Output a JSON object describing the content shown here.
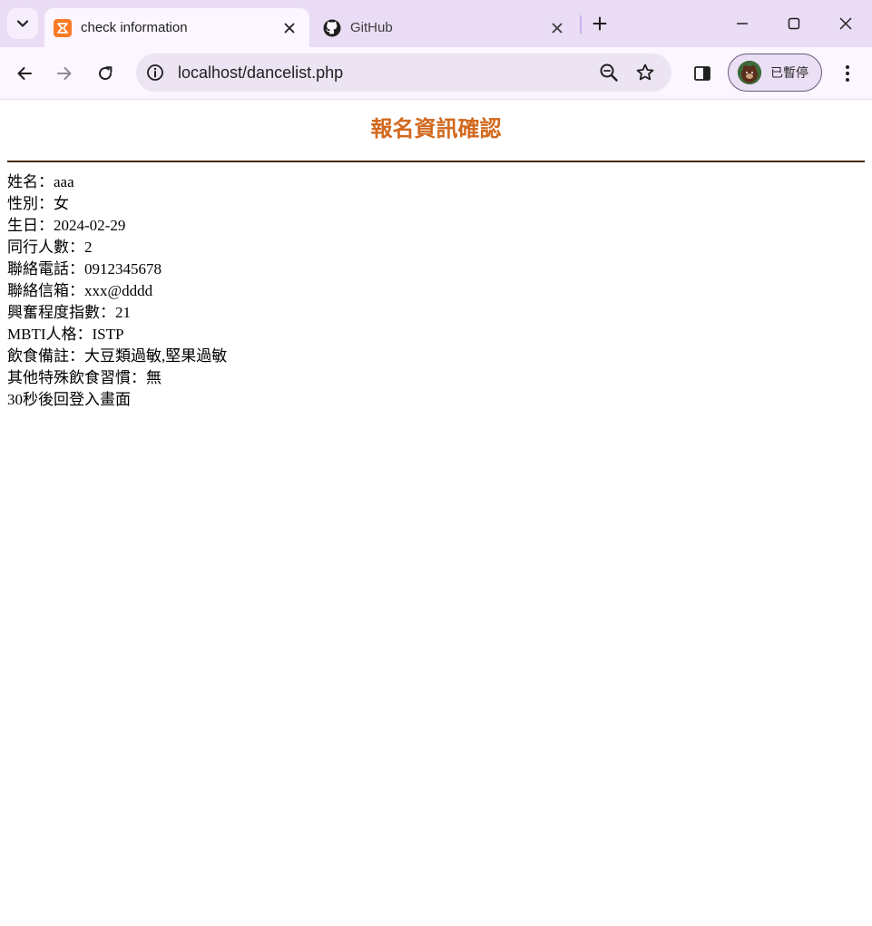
{
  "browser": {
    "tabs": [
      {
        "title": "check information",
        "active": true
      },
      {
        "title": "GitHub",
        "active": false
      }
    ],
    "url": "localhost/dancelist.php",
    "profile_label": "已暫停"
  },
  "page": {
    "title": "報名資訊確認",
    "lines": [
      "姓名：aaa",
      "性別：女",
      "生日：2024-02-29",
      "同行人數：2",
      "聯絡電話：0912345678",
      "聯絡信箱：xxx@dddd",
      "興奮程度指數：21",
      "MBTI人格：ISTP",
      "飲食備註：大豆類過敏,堅果過敏",
      "其他特殊飲食習慣：無",
      "30秒後回登入畫面"
    ]
  },
  "colors": {
    "title": "#d2691e",
    "divider": "#4a2a12",
    "tabstrip": "#e9dcf4",
    "toolbar": "#fbf6ff"
  },
  "icons": [
    "tab-search-icon",
    "xampp-favicon-icon",
    "close-icon",
    "github-icon",
    "plus-icon",
    "minimize-icon",
    "maximize-icon",
    "back-arrow-icon",
    "forward-arrow-icon",
    "reload-icon",
    "site-info-icon",
    "zoom-icon",
    "star-icon",
    "side-panel-icon",
    "kebab-menu-icon"
  ]
}
